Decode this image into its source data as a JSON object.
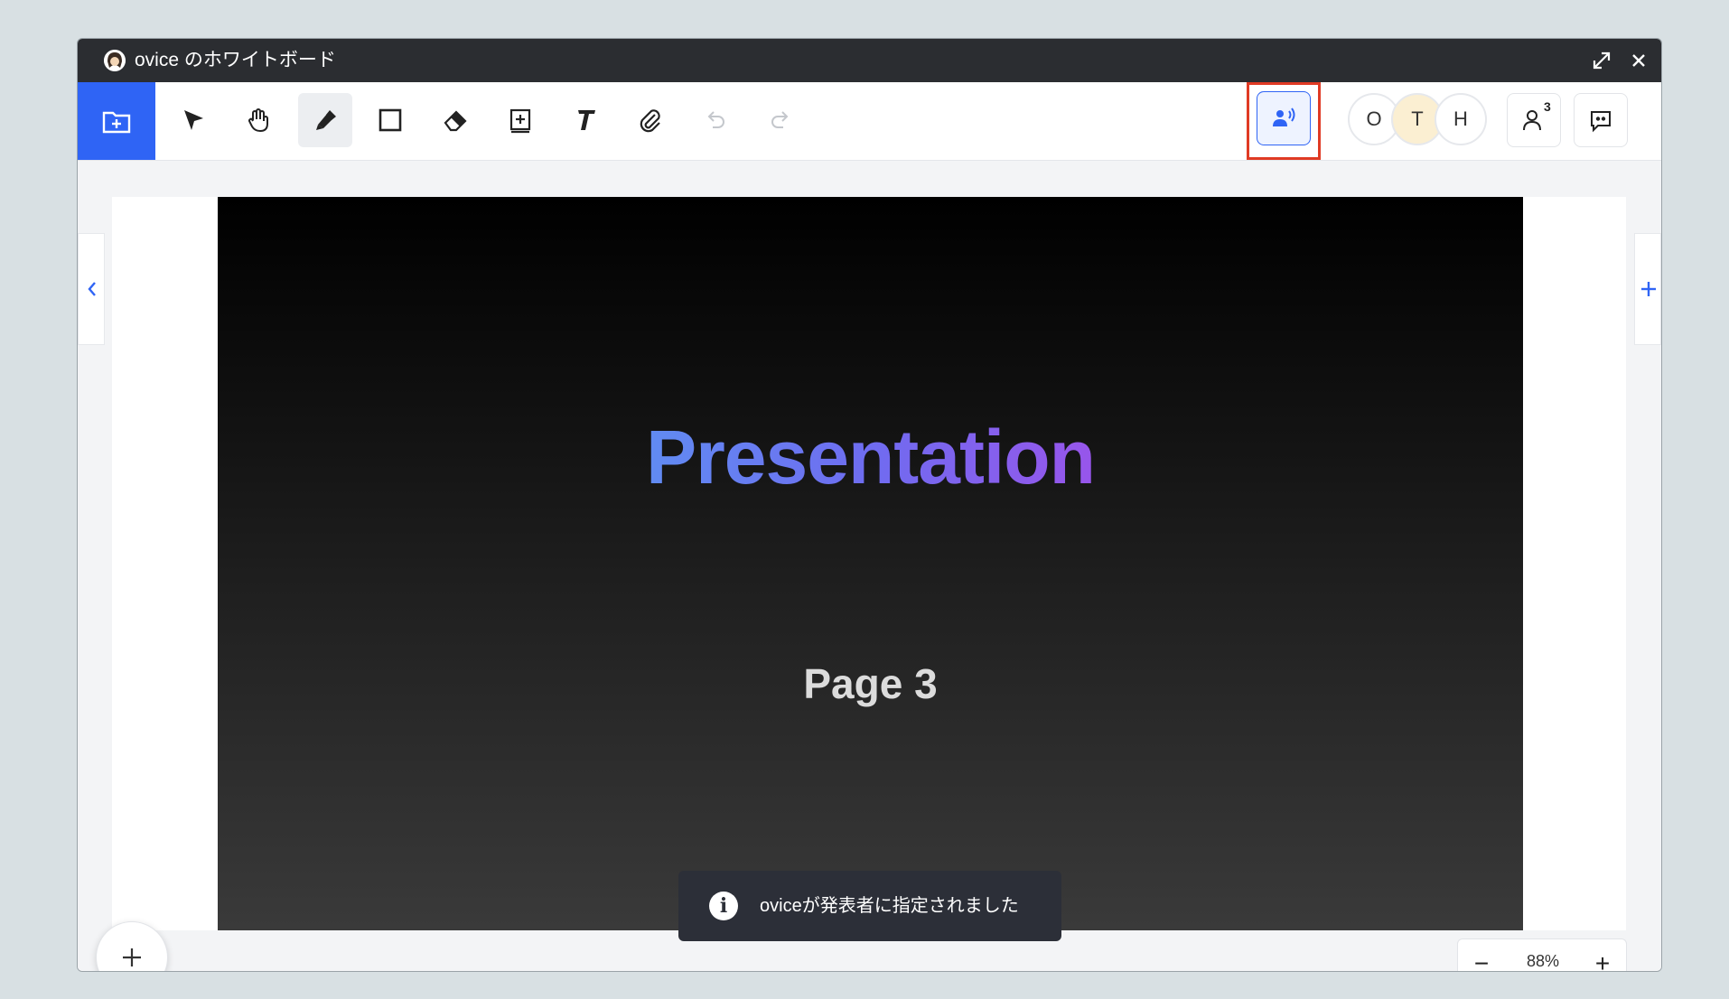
{
  "window": {
    "title": "ovice のホワイトボード"
  },
  "toolbar": {
    "tools": [
      {
        "name": "pointer",
        "icon": "cursor-arrow-icon"
      },
      {
        "name": "hand",
        "icon": "hand-icon"
      },
      {
        "name": "pen",
        "icon": "pen-icon",
        "active": true
      },
      {
        "name": "rectangle",
        "icon": "rectangle-icon"
      },
      {
        "name": "eraser",
        "icon": "eraser-icon"
      },
      {
        "name": "add-frame",
        "icon": "add-frame-icon"
      },
      {
        "name": "text",
        "icon": "text-icon"
      },
      {
        "name": "attach",
        "icon": "paperclip-icon"
      },
      {
        "name": "undo",
        "icon": "undo-icon"
      },
      {
        "name": "redo",
        "icon": "redo-icon"
      }
    ],
    "members": [
      {
        "initial": "O",
        "bg": "#ffffff"
      },
      {
        "initial": "T",
        "bg": "#fbefd2"
      },
      {
        "initial": "H",
        "bg": "#ffffff"
      }
    ],
    "participants_count": "3"
  },
  "slide": {
    "title": "Presentation",
    "subtitle": "Page 3"
  },
  "toast": {
    "message": "oviceが発表者に指定されました"
  },
  "zoom": {
    "minus": "−",
    "level": "88%",
    "plus": "+"
  },
  "colors": {
    "accent": "#2f64f5",
    "highlight": "#e03a24"
  }
}
